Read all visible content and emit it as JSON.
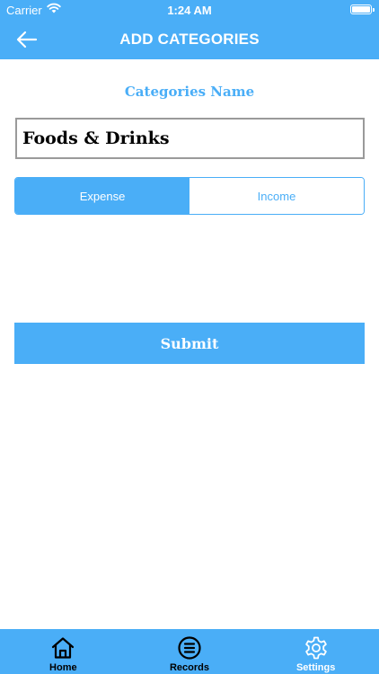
{
  "status_bar": {
    "carrier": "Carrier",
    "time": "1:24 AM"
  },
  "header": {
    "title": "ADD CATEGORIES",
    "back_icon": "arrow-left-icon"
  },
  "form": {
    "label": "Categories Name",
    "name_value": "Foods & Drinks",
    "type_options": [
      {
        "label": "Expense",
        "selected": true
      },
      {
        "label": "Income",
        "selected": false
      }
    ],
    "submit_label": "Submit"
  },
  "tab_bar": {
    "items": [
      {
        "label": "Home",
        "icon": "home-icon"
      },
      {
        "label": "Records",
        "icon": "records-icon"
      },
      {
        "label": "Settings",
        "icon": "gear-icon"
      }
    ]
  },
  "colors": {
    "accent": "#4aaef7",
    "text_dark": "#000000",
    "white": "#ffffff",
    "input_border": "#9a9a9a"
  }
}
